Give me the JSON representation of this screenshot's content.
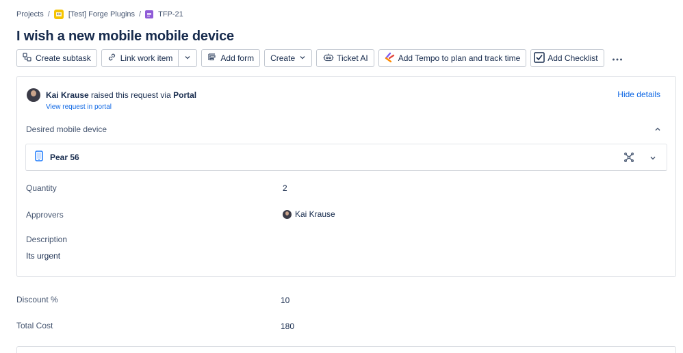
{
  "breadcrumb": {
    "projects": "Projects",
    "project": "[Test] Forge Plugins",
    "issue_key": "TFP-21"
  },
  "page_title": "I wish a new mobile mobile device",
  "toolbar": {
    "create_subtask": "Create subtask",
    "link_work_item": "Link work item",
    "add_form": "Add form",
    "create": "Create",
    "ticket_ai": "Ticket AI",
    "add_tempo": "Add Tempo to plan and track time",
    "add_checklist": "Add Checklist"
  },
  "request": {
    "reporter_name": "Kai Krause",
    "raised_text": "raised this request via",
    "channel": "Portal",
    "view_link": "View request in portal",
    "hide_details": "Hide details",
    "device_section_label": "Desired mobile device",
    "device_name": "Pear 56",
    "fields": {
      "quantity_label": "Quantity",
      "quantity_value": "2",
      "approvers_label": "Approvers",
      "approver_name": "Kai Krause",
      "description_label": "Description",
      "description_value": "Its urgent"
    }
  },
  "details": {
    "discount_label": "Discount %",
    "discount_value": "10",
    "total_cost_label": "Total Cost",
    "total_cost_value": "180"
  },
  "icons": {
    "project": "project-icon",
    "issue": "issue-type-icon",
    "subtask": "subtask-icon",
    "link": "link-icon",
    "form": "form-icon",
    "robot": "robot-icon",
    "tempo": "tempo-icon",
    "checklist": "checklist-icon",
    "phone": "phone-icon"
  },
  "colors": {
    "link": "#0c66e4",
    "project_icon": "#f5c400",
    "issue_icon": "#8f5bd7",
    "tempo_purple": "#7f5af0",
    "tempo_orange": "#ff8b00",
    "phone_blue": "#1d7afc"
  }
}
